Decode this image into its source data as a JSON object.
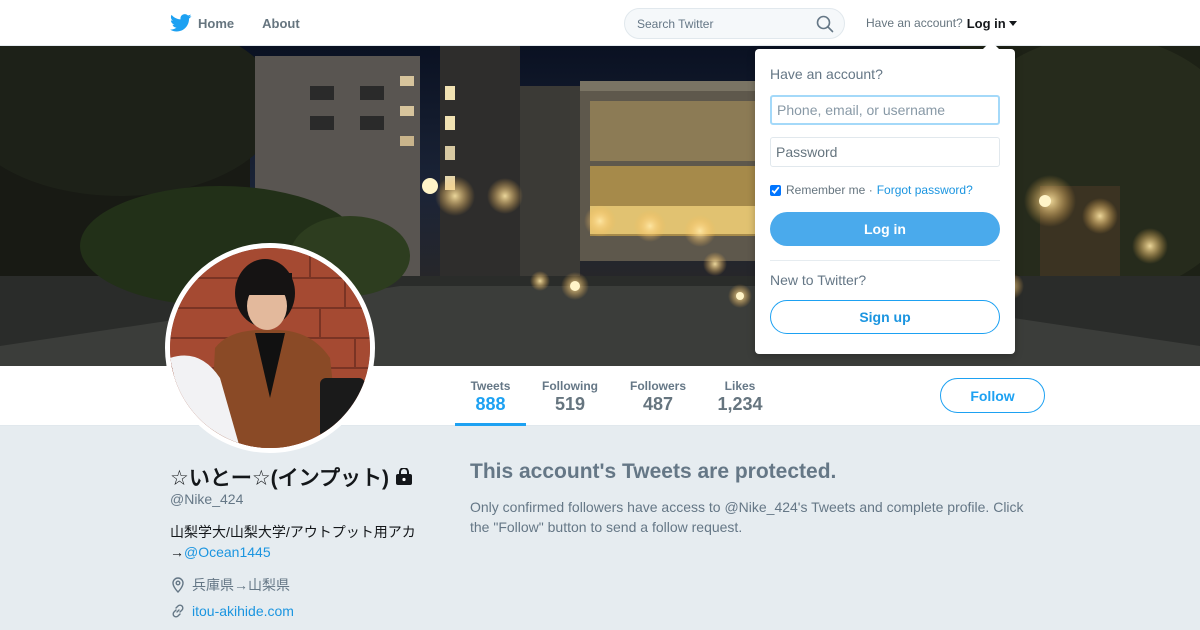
{
  "topnav": {
    "home_label": "Home",
    "about_label": "About",
    "search_placeholder": "Search Twitter",
    "have_account": "Have an account?",
    "login_label": "Log in",
    "brand_color": "#1da1f2",
    "icons": [
      "twitter-bird-icon",
      "search-icon",
      "chevron-down-icon"
    ]
  },
  "profile": {
    "name": "☆いとー☆(インプット)",
    "handle": "@Nike_424",
    "bio_text": "山梨学大/山梨大学/アウトプット用アカ→",
    "bio_link": "@Ocean1445",
    "location": "兵庫県→山梨県",
    "website": "itou-akihide.com",
    "protected_icon": "lock-icon"
  },
  "stats": {
    "tweets_label": "Tweets",
    "tweets_value": "888",
    "following_label": "Following",
    "following_value": "519",
    "followers_label": "Followers",
    "followers_value": "487",
    "likes_label": "Likes",
    "likes_value": "1,234",
    "active_tab": "Tweets"
  },
  "follow_label": "Follow",
  "protected": {
    "title": "This account's Tweets are protected.",
    "text": "Only confirmed followers have access to @Nike_424's Tweets and complete profile. Click the \"Follow\" button to send a follow request."
  },
  "login_dropdown": {
    "title": "Have an account?",
    "username_placeholder": "Phone, email, or username",
    "password_placeholder": "Password",
    "remember_label": "Remember me",
    "separator": "·",
    "forgot_label": "Forgot password?",
    "remember_checked": true,
    "login_button": "Log in",
    "new_to_twitter": "New to Twitter?",
    "signup_button": "Sign up"
  }
}
